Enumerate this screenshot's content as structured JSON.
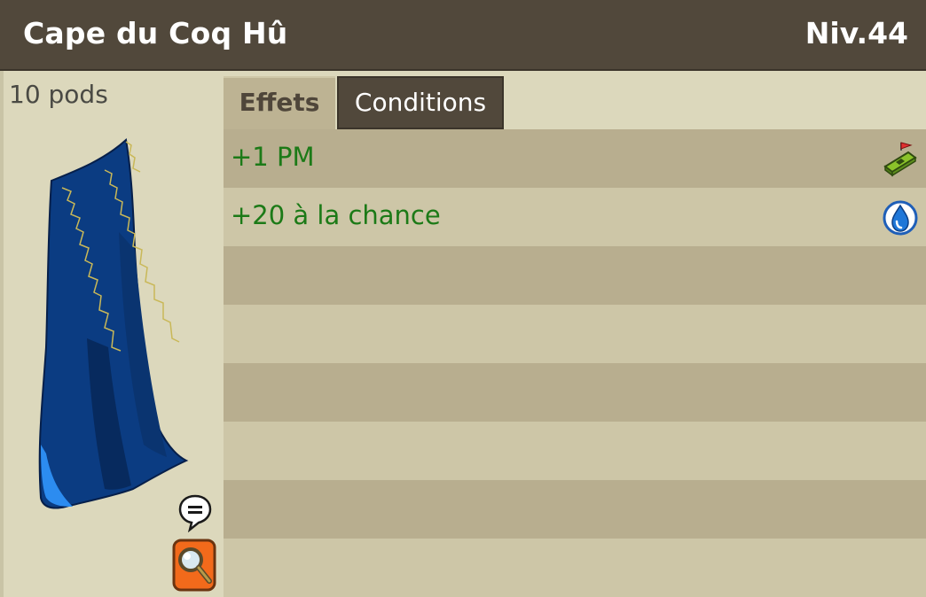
{
  "header": {
    "item_name": "Cape du Coq Hû",
    "level": "Niv.44"
  },
  "item": {
    "weight": "10 pods",
    "image_icon": "blue-cape-icon",
    "chat_icon": "speech-bubble-icon",
    "inspect_icon": "magnifier-icon"
  },
  "tabs": [
    {
      "label": "Effets",
      "active": true
    },
    {
      "label": "Conditions",
      "active": false
    }
  ],
  "effects": [
    {
      "text": "+1 PM",
      "icon": "movement-points-icon"
    },
    {
      "text": "+20 à la chance",
      "icon": "water-drop-icon"
    },
    {
      "text": "",
      "icon": ""
    },
    {
      "text": "",
      "icon": ""
    },
    {
      "text": "",
      "icon": ""
    },
    {
      "text": "",
      "icon": ""
    },
    {
      "text": "",
      "icon": ""
    },
    {
      "text": "",
      "icon": ""
    }
  ],
  "colors": {
    "header_bg": "#51483b",
    "panel_bg": "#dcd8bc",
    "row_dark": "#b8ae8f",
    "row_light": "#cdc6a7",
    "effect_text": "#1c7a17",
    "cape_blue": "#0a3a7a"
  }
}
